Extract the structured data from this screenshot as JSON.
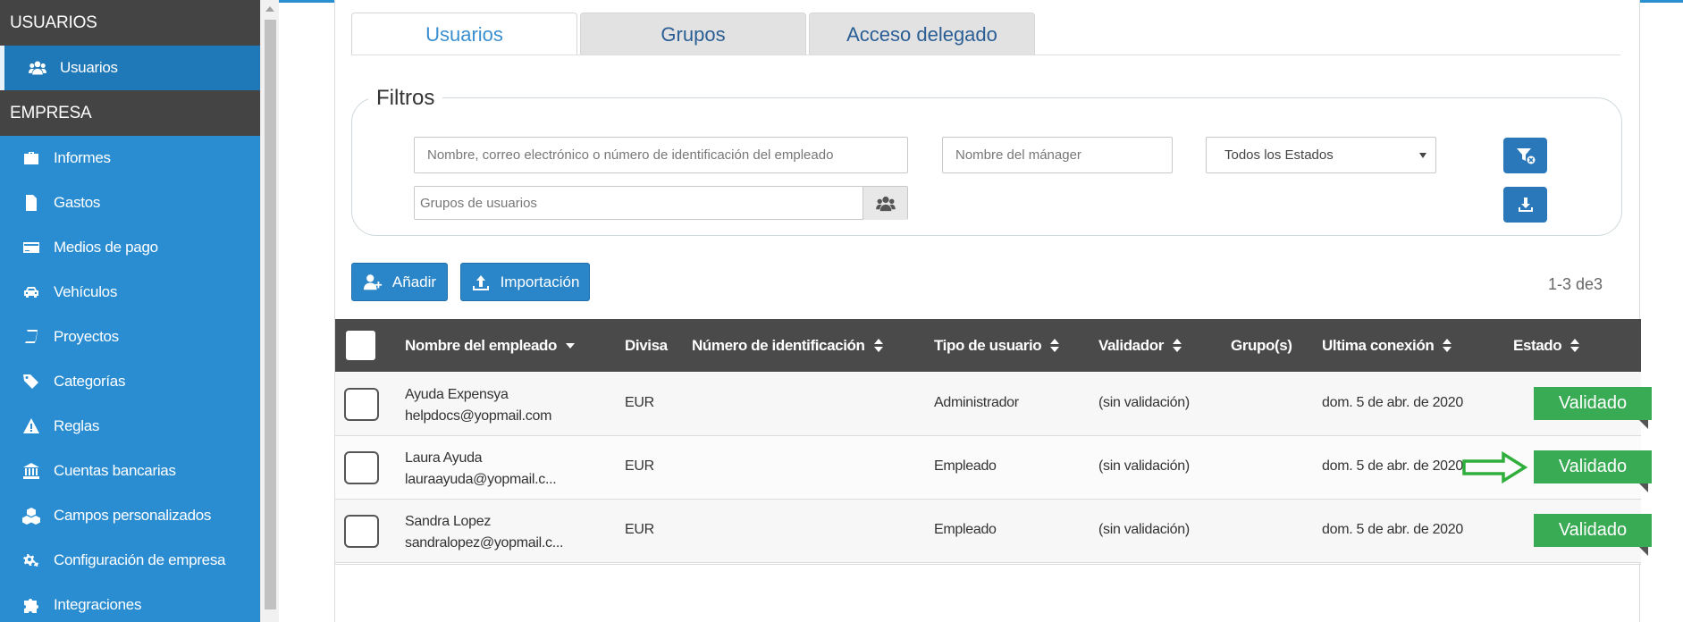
{
  "sidebar": {
    "section_users": "USUARIOS",
    "users_item": "Usuarios",
    "section_company": "EMPRESA",
    "items": [
      {
        "label": "Informes",
        "icon": "briefcase-icon"
      },
      {
        "label": "Gastos",
        "icon": "document-icon"
      },
      {
        "label": "Medios de pago",
        "icon": "credit-card-icon"
      },
      {
        "label": "Vehículos",
        "icon": "car-icon"
      },
      {
        "label": "Proyectos",
        "icon": "book-icon"
      },
      {
        "label": "Categorías",
        "icon": "tags-icon"
      },
      {
        "label": "Reglas",
        "icon": "warning-icon"
      },
      {
        "label": "Cuentas bancarias",
        "icon": "bank-icon"
      },
      {
        "label": "Campos personalizados",
        "icon": "cubes-icon"
      },
      {
        "label": "Configuración de empresa",
        "icon": "gears-icon"
      },
      {
        "label": "Integraciones",
        "icon": "puzzle-icon"
      }
    ]
  },
  "tabs": [
    {
      "label": "Usuarios",
      "active": true
    },
    {
      "label": "Grupos",
      "active": false
    },
    {
      "label": "Acceso delegado",
      "active": false
    }
  ],
  "filters": {
    "legend": "Filtros",
    "employee_placeholder": "Nombre, correo electrónico o número de identificación del empleado",
    "manager_placeholder": "Nombre del mánager",
    "status_selected": "Todos los Estados",
    "groups_placeholder": "Grupos de usuarios"
  },
  "actions": {
    "add_label": "Añadir",
    "import_label": "Importación"
  },
  "pagination": {
    "count": "1-3 de3"
  },
  "table": {
    "headers": {
      "name": "Nombre del empleado",
      "currency": "Divisa",
      "id_number": "Número de identificación",
      "user_type": "Tipo de usuario",
      "validator": "Validador",
      "groups": "Grupo(s)",
      "last_login": "Ultima conexión",
      "status": "Estado"
    },
    "rows": [
      {
        "name": "Ayuda Expensya",
        "email": "helpdocs@yopmail.com",
        "currency": "EUR",
        "user_type": "Administrador",
        "validator": "(sin validación)",
        "last_login": "dom. 5 de abr. de 2020",
        "status": "Validado"
      },
      {
        "name": "Laura Ayuda",
        "email": "lauraayuda@yopmail.c...",
        "currency": "EUR",
        "user_type": "Empleado",
        "validator": "(sin validación)",
        "last_login": "dom. 5 de abr. de 2020",
        "status": "Validado"
      },
      {
        "name": "Sandra Lopez",
        "email": "sandralopez@yopmail.c...",
        "currency": "EUR",
        "user_type": "Empleado",
        "validator": "(sin validación)",
        "last_login": "dom. 5 de abr. de 2020",
        "status": "Validado"
      }
    ]
  },
  "colors": {
    "sidebar": "#2a8dd2",
    "sidebar_section": "#444444",
    "table_header": "#4a4a4a",
    "status_badge": "#3aab55",
    "button": "#2a86c8"
  }
}
